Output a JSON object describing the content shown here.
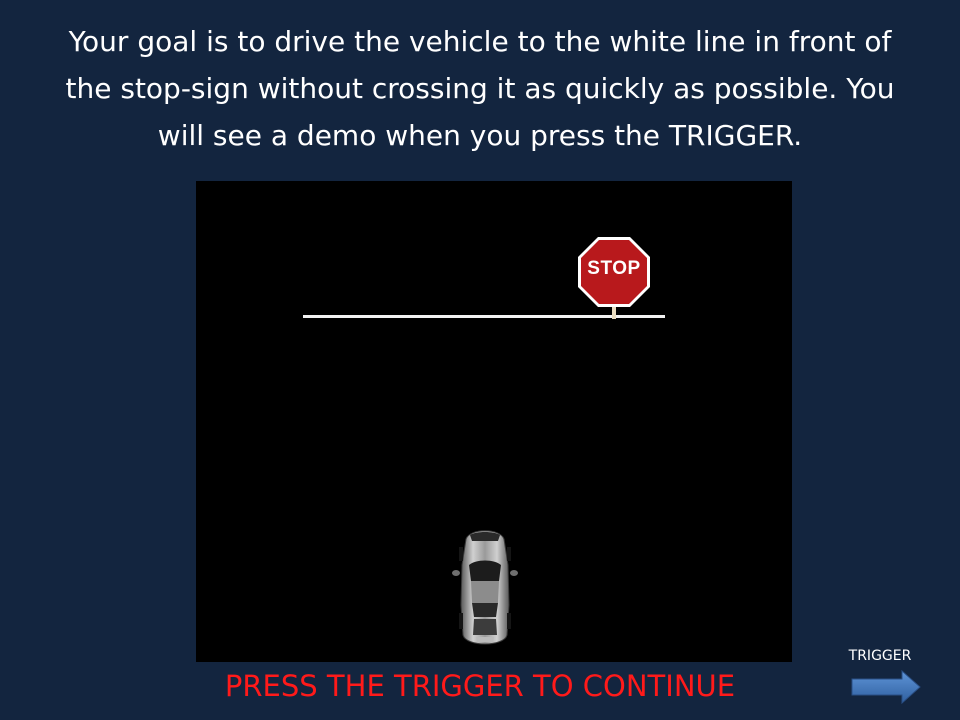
{
  "instructions": {
    "line1": "Your goal is to drive the vehicle to the white line in front of",
    "line2": "the stop-sign without crossing it as quickly as possible. You",
    "line3": "will see a demo when you press the TRIGGER."
  },
  "scene": {
    "stop_sign_text": "STOP",
    "colors": {
      "background": "#000000",
      "line": "#f2f2f2",
      "sign": "#b8191c"
    }
  },
  "prompt": {
    "press_trigger": "PRESS THE TRIGGER TO CONTINUE",
    "color": "#ff1a1a"
  },
  "nav": {
    "trigger_label": "TRIGGER",
    "arrow_icon": "right-arrow-icon",
    "arrow_color": "#3f78c4"
  },
  "theme": {
    "slide_background": "#13253f",
    "text_color": "#ffffff"
  }
}
